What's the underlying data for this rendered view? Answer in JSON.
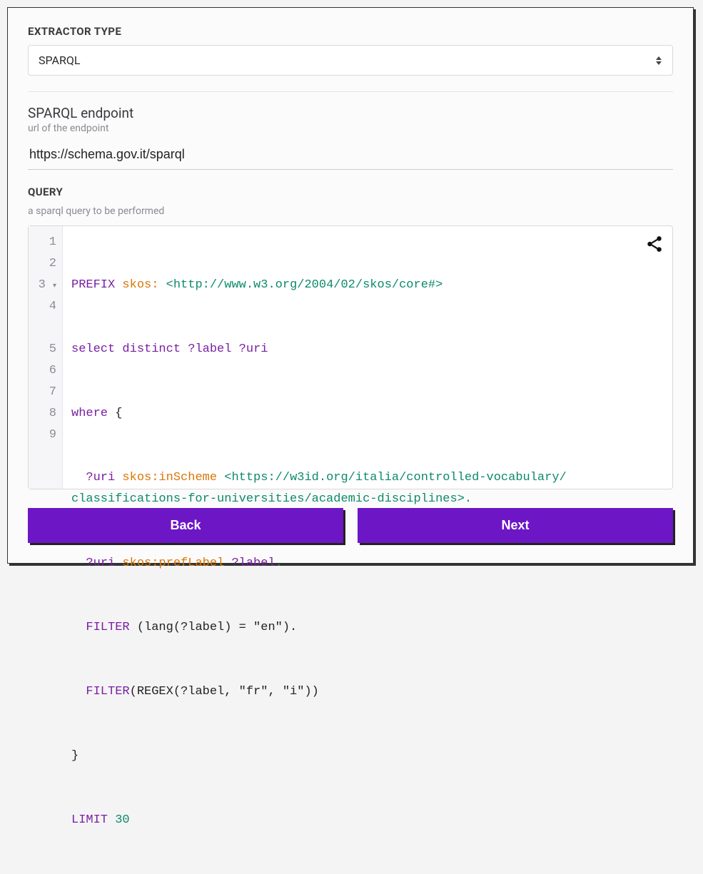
{
  "extractor": {
    "label": "EXTRACTOR TYPE",
    "selected": "SPARQL"
  },
  "endpoint": {
    "label": "SPARQL endpoint",
    "help": "url of the endpoint",
    "value": "https://schema.gov.it/sparql"
  },
  "query": {
    "label": "QUERY",
    "help": "a sparql query to be performed",
    "gutter": [
      "1",
      "2",
      "3",
      "4",
      "5",
      "6",
      "7",
      "8",
      "9"
    ],
    "fold_line": "3",
    "tokens": {
      "l1_kw": "PREFIX",
      "l1_pfx": "skos:",
      "l1_uri": "<http://www.w3.org/2004/02/skos/core#>",
      "l2_kw1": "select",
      "l2_kw2": "distinct",
      "l2_v1": "?label",
      "l2_v2": "?uri",
      "l3_kw": "where",
      "l3_brace": "{",
      "l4_var": "?uri",
      "l4_pfx": "skos:inScheme",
      "l4_uri1": "<https://w3id.org/italia/controlled-vocabulary/",
      "l4_uri2": "classifications-for-universities/academic-disciplines>",
      "l4_dot": ".",
      "l5_var": "?uri",
      "l5_pfx": "skos:prefLabel",
      "l5_var2": "?label",
      "l5_dot": ".",
      "l6_filter": "FILTER",
      "l6_body": " (lang(?label) = \"en\").",
      "l7_filter": "FILTER",
      "l7_body": "(REGEX(?label, \"fr\", \"i\"))",
      "l8_brace": "}",
      "l9_kw": "LIMIT",
      "l9_num": "30"
    }
  },
  "buttons": {
    "back": "Back",
    "next": "Next"
  }
}
